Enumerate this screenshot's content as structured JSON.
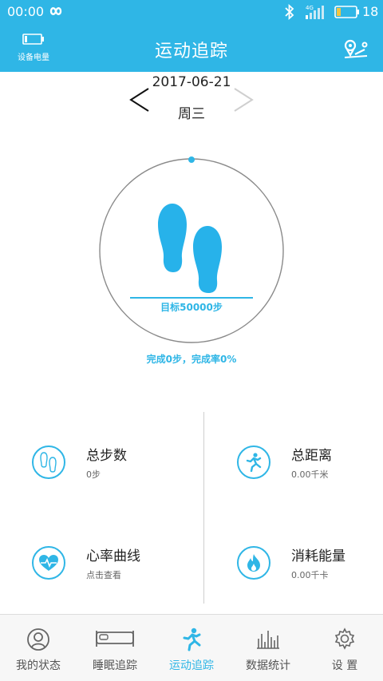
{
  "status_bar": {
    "time": "00:00",
    "network": "4G",
    "battery_level": "18"
  },
  "header": {
    "device_battery_label": "设备电量",
    "title": "运动追踪"
  },
  "date_nav": {
    "date": "2017-06-21",
    "weekday": "周三"
  },
  "progress": {
    "goal_text": "目标50000步",
    "completion_text": "完成0步，完成率0%",
    "completion_fraction": 0
  },
  "stats": {
    "total_steps": {
      "label": "总步数",
      "value": "0步"
    },
    "total_distance": {
      "label": "总距离",
      "value": "0.00千米"
    },
    "heart_rate": {
      "label": "心率曲线",
      "value": "点击查看"
    },
    "calories": {
      "label": "消耗能量",
      "value": "0.00千卡"
    }
  },
  "bottom_nav": {
    "items": [
      {
        "label": "我的状态",
        "icon": "profile-icon",
        "active": false
      },
      {
        "label": "睡眠追踪",
        "icon": "bed-icon",
        "active": false
      },
      {
        "label": "运动追踪",
        "icon": "running-icon",
        "active": true
      },
      {
        "label": "数据统计",
        "icon": "bar-chart-icon",
        "active": false
      },
      {
        "label": "设 置",
        "icon": "gear-icon",
        "active": false
      }
    ]
  },
  "colors": {
    "primary": "#2fb6e6",
    "ring_track": "#8a8a8a",
    "footprint": "#27b2ea"
  }
}
